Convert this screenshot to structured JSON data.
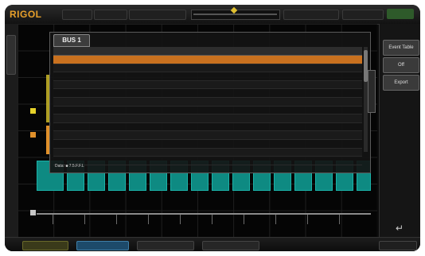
{
  "app": {
    "logo": "RIGOL"
  },
  "colors": {
    "accent": "#e8a02a",
    "bus": "#0e8a82",
    "selected_row": "#c9711f",
    "trigger": "#2e5a2a"
  },
  "event_table": {
    "tab_label": "BUS 1",
    "footer": "Data: ■ 7.5.F.F.L"
  },
  "right_panel": {
    "buttons": [
      "Event Table",
      "Off",
      "Export"
    ],
    "return_icon": "return-icon"
  },
  "icons": [
    "trigger-marker-icon",
    "scrollbar-icon",
    "return-icon"
  ]
}
